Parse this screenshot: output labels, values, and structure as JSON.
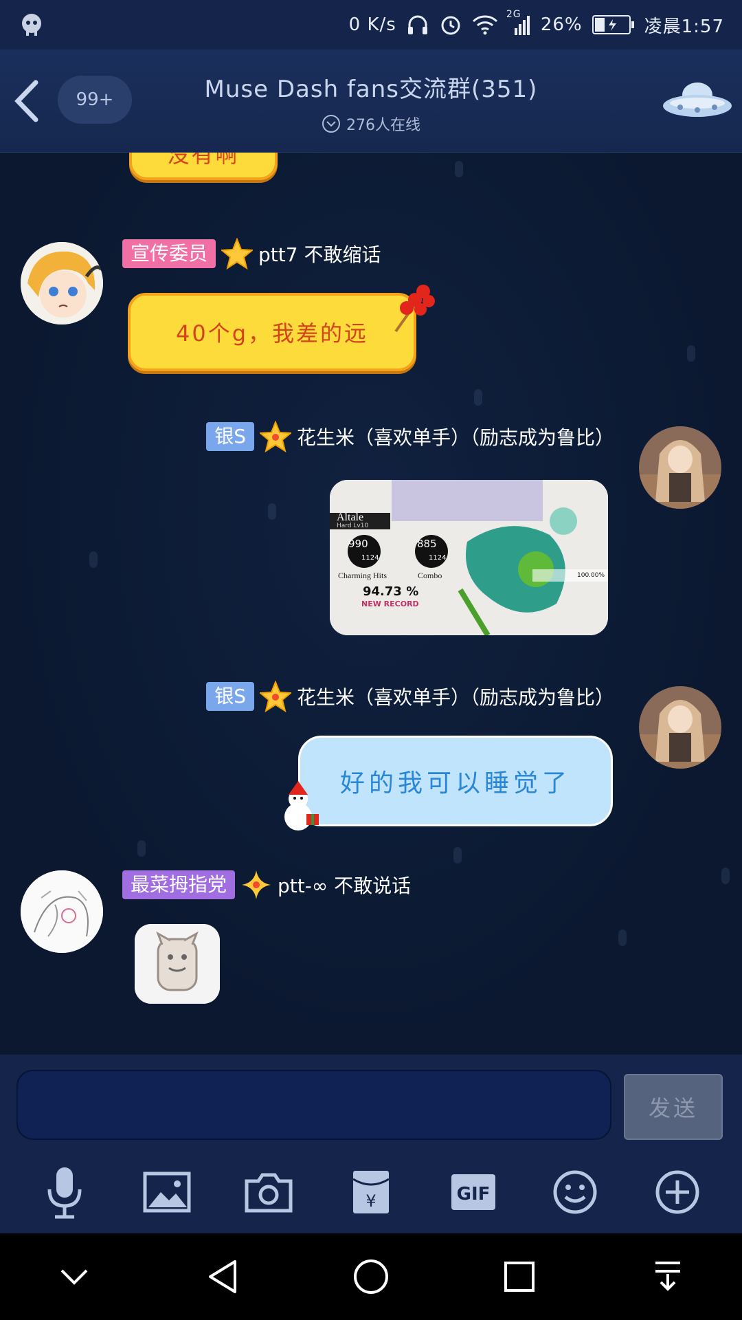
{
  "status_bar": {
    "net_speed": "0 K/s",
    "signal_label": "2G",
    "battery": "26%",
    "time": "凌晨1:57"
  },
  "header": {
    "back_icon": "chevron-left-icon",
    "unread_count": "99+",
    "title": "Muse Dash fans交流群(351)",
    "online": "276人在线",
    "ufo_icon": "ufo-icon"
  },
  "messages": [
    {
      "type": "text-partial",
      "side": "left",
      "text": "没有啊"
    },
    {
      "type": "text",
      "side": "left",
      "badge": "宣传委员",
      "badge_color": "#f06fa5",
      "name": "ptt7 不敢缩话",
      "text": "40个g，我差的远"
    },
    {
      "type": "image",
      "side": "right",
      "badge": "银S",
      "badge_color": "#7aa7ec",
      "name": "花生米（喜欢单手）（励志成为鲁比）",
      "result": {
        "song": "Altale",
        "level": "Hard Lv10",
        "charming_hits_top": "990",
        "charming_hits_bottom": "1124",
        "charming_label": "Charming Hits",
        "combo_top": "885",
        "combo_bottom": "1124",
        "combo_label": "Combo",
        "accuracy": "94.73 %",
        "new_record": "NEW RECORD",
        "percent": "100.00%"
      }
    },
    {
      "type": "text",
      "side": "right",
      "badge": "银S",
      "badge_color": "#7aa7ec",
      "name": "花生米（喜欢单手）（励志成为鲁比）",
      "text": "好的我可以睡觉了"
    },
    {
      "type": "sticker",
      "side": "left",
      "badge": "最菜拇指党",
      "badge_color": "#a06ee0",
      "name": "ptt-∞ 不敢说话"
    }
  ],
  "input": {
    "placeholder": "",
    "send_label": "发送"
  },
  "toolbar": [
    "microphone-icon",
    "image-icon",
    "camera-icon",
    "red-envelope-icon",
    "gif-icon",
    "emoji-icon",
    "plus-icon"
  ],
  "toolbar_labels": {
    "gif": "GIF"
  },
  "nav_bar": [
    "chevron-down-icon",
    "back-triangle-icon",
    "home-circle-icon",
    "recents-square-icon",
    "notification-pull-icon"
  ]
}
